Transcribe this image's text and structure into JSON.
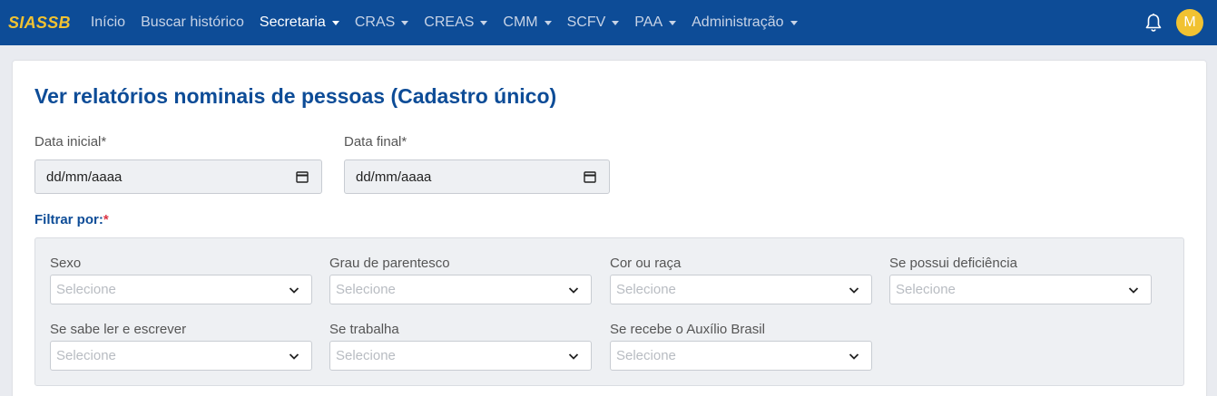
{
  "nav": {
    "brand": "SIASSB",
    "items": [
      {
        "label": "Início",
        "dropdown": false,
        "active": false
      },
      {
        "label": "Buscar histórico",
        "dropdown": false,
        "active": false
      },
      {
        "label": "Secretaria",
        "dropdown": true,
        "active": true
      },
      {
        "label": "CRAS",
        "dropdown": true,
        "active": false
      },
      {
        "label": "CREAS",
        "dropdown": true,
        "active": false
      },
      {
        "label": "CMM",
        "dropdown": true,
        "active": false
      },
      {
        "label": "SCFV",
        "dropdown": true,
        "active": false
      },
      {
        "label": "PAA",
        "dropdown": true,
        "active": false
      },
      {
        "label": "Administração",
        "dropdown": true,
        "active": false
      }
    ],
    "avatar_initial": "M"
  },
  "page": {
    "title": "Ver relatórios nominais de pessoas (Cadastro único)",
    "date_start": {
      "label": "Data inicial*",
      "value": "dd/mm/aaaa"
    },
    "date_end": {
      "label": "Data final*",
      "value": "dd/mm/aaaa"
    },
    "filter": {
      "label": "Filtrar por:",
      "required_mark": "*",
      "selects": [
        {
          "label": "Sexo",
          "placeholder": "Selecione"
        },
        {
          "label": "Grau de parentesco",
          "placeholder": "Selecione"
        },
        {
          "label": "Cor ou raça",
          "placeholder": "Selecione"
        },
        {
          "label": "Se possui deficiência",
          "placeholder": "Selecione"
        },
        {
          "label": "Se sabe ler e escrever",
          "placeholder": "Selecione"
        },
        {
          "label": "Se trabalha",
          "placeholder": "Selecione"
        },
        {
          "label": "Se recebe o Auxílio Brasil",
          "placeholder": "Selecione"
        }
      ]
    }
  },
  "colors": {
    "navbar": "#0d4c97",
    "brand": "#f1c232",
    "title": "#0d4c97",
    "required": "#dc3545"
  },
  "icons": {
    "notifications": "bell-icon",
    "calendar": "calendar-icon",
    "dropdown": "chevron-down-icon"
  }
}
